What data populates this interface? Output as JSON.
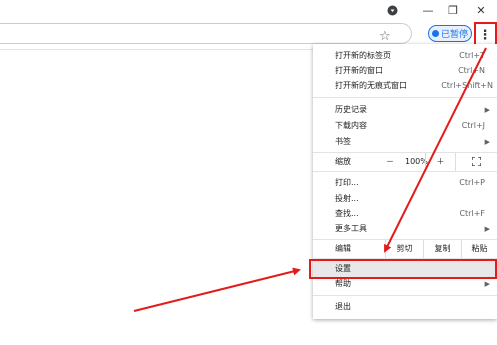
{
  "window": {
    "profile_icon": "circle-dot",
    "minimize": "—",
    "restore": "❐",
    "close": "✕"
  },
  "toolbar": {
    "star": "☆",
    "paused_label": "已暂停",
    "menu_icon": "⋮"
  },
  "menu": {
    "new_tab": {
      "label": "打开新的标签页",
      "shortcut": "Ctrl+T"
    },
    "new_window": {
      "label": "打开新的窗口",
      "shortcut": "Ctrl+N"
    },
    "incognito": {
      "label": "打开新的无痕式窗口",
      "shortcut": "Ctrl+Shift+N"
    },
    "history": {
      "label": "历史记录"
    },
    "downloads": {
      "label": "下载内容",
      "shortcut": "Ctrl+J"
    },
    "bookmarks": {
      "label": "书签"
    },
    "zoom": {
      "label": "缩放",
      "minus": "－",
      "value": "100%",
      "plus": "＋"
    },
    "print": {
      "label": "打印...",
      "shortcut": "Ctrl+P"
    },
    "cast": {
      "label": "投射..."
    },
    "find": {
      "label": "查找...",
      "shortcut": "Ctrl+F"
    },
    "more_tools": {
      "label": "更多工具"
    },
    "edit": {
      "label": "编辑",
      "cut": "剪切",
      "copy": "复制",
      "paste": "粘贴"
    },
    "settings": {
      "label": "设置"
    },
    "help": {
      "label": "帮助"
    },
    "exit": {
      "label": "退出"
    }
  },
  "colors": {
    "highlight": "#e31b1b",
    "accent": "#1a73e8"
  }
}
